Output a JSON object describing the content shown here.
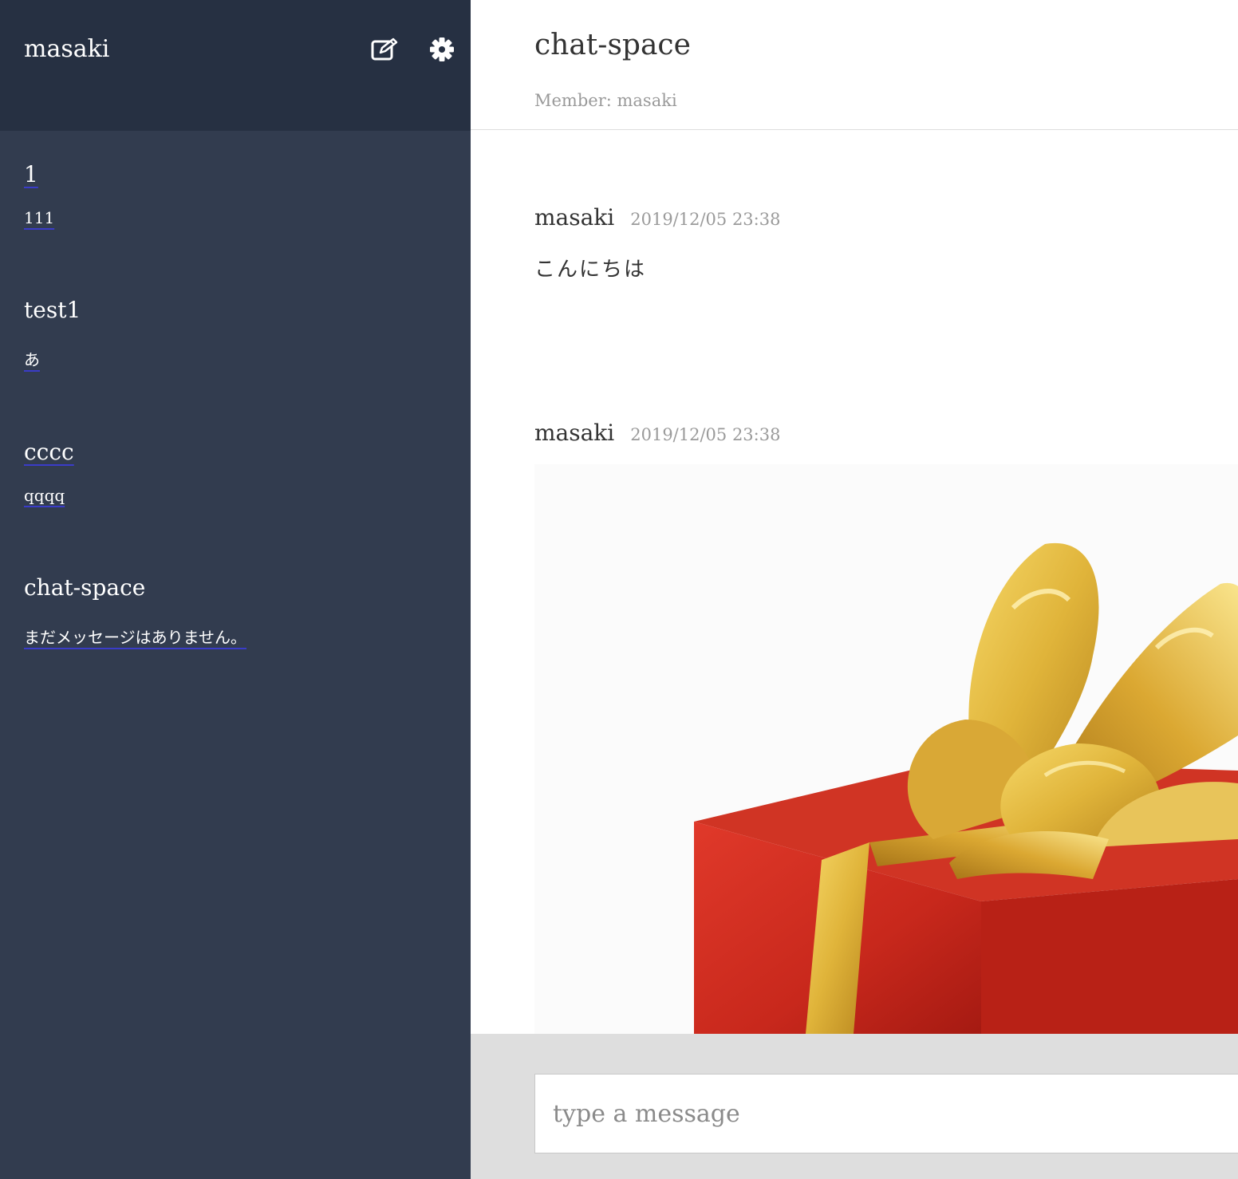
{
  "sidebar": {
    "user_name": "masaki",
    "icons": {
      "edit": "edit-icon",
      "settings": "gear-icon"
    },
    "groups": [
      {
        "name": "1",
        "last_message": "111"
      },
      {
        "name": "test1",
        "last_message": "あ"
      },
      {
        "name": "cccc",
        "last_message": "qqqq"
      },
      {
        "name": "chat-space",
        "last_message": "まだメッセージはありません。"
      }
    ]
  },
  "main": {
    "group_title": "chat-space",
    "members_label": "Member: masaki",
    "messages": [
      {
        "user": "masaki",
        "date": "2019/12/05 23:38",
        "text": "こんにちは"
      },
      {
        "user": "masaki",
        "date": "2019/12/05 23:38",
        "image": "gift-box-image"
      }
    ],
    "form": {
      "placeholder": "type a message"
    }
  },
  "colors": {
    "sidebar_bg": "#323c4f",
    "sidebar_header_bg": "#263042",
    "form_bg": "#dedede",
    "gift_red": "#c8281c",
    "ribbon_gold": "#e0b43a"
  }
}
